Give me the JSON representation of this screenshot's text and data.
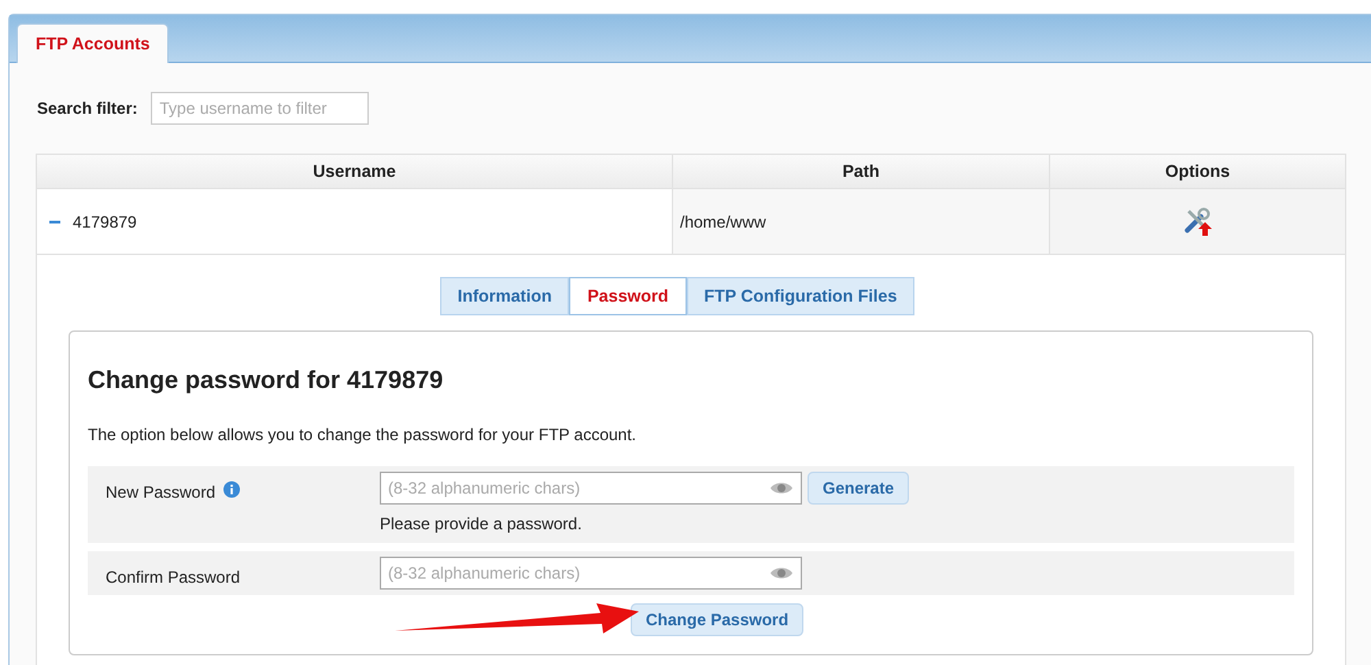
{
  "tabs": [
    {
      "label": "FTP Accounts",
      "selected": true
    }
  ],
  "search": {
    "label": "Search filter:",
    "placeholder": "Type username to filter"
  },
  "table": {
    "columns": [
      "Username",
      "Path",
      "Options"
    ],
    "rows": [
      {
        "username": "4179879",
        "path": "/home/www",
        "expanded": true
      }
    ]
  },
  "detail_tabs": [
    {
      "label": "Information",
      "selected": false
    },
    {
      "label": "Password",
      "selected": true
    },
    {
      "label": "FTP Configuration Files",
      "selected": false
    }
  ],
  "panel": {
    "title": "Change password for 4179879",
    "description": "The option below allows you to change the password for your FTP account.",
    "fields": [
      {
        "label": "New Password",
        "info": true,
        "placeholder": "(8-32 alphanumeric chars)",
        "button": "Generate",
        "error": "Please provide a password."
      },
      {
        "label": "Confirm Password",
        "info": false,
        "placeholder": "(8-32 alphanumeric chars)"
      }
    ],
    "submit": "Change Password"
  }
}
